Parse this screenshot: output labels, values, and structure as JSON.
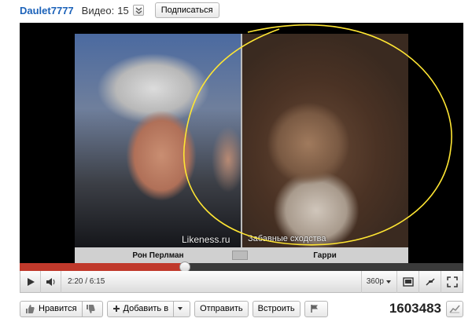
{
  "header": {
    "channel_name": "Daulet7777",
    "videos_label": "Видео:",
    "videos_count": "15",
    "subscribe_label": "Подписаться"
  },
  "video": {
    "watermark_site": "Likeness.ru",
    "watermark_tagline": "Забавные сходства",
    "caption_left": "Рон Перлман",
    "caption_right": "Гарри"
  },
  "player": {
    "time_display": "2:20 / 6:15",
    "progress_fraction": 0.373,
    "quality_label": "360p"
  },
  "actions": {
    "like_label": "Нравится",
    "add_to_label": "Добавить в",
    "share_label": "Отправить",
    "embed_label": "Встроить",
    "view_count": "1603483"
  },
  "colors": {
    "channel_link": "#1c62b9",
    "progress_played": "#c0392b",
    "annotation_circle": "#ffe633"
  }
}
